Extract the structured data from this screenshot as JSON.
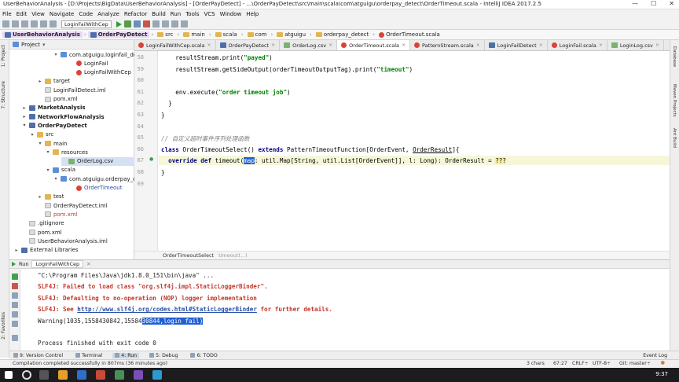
{
  "window": {
    "title": "UserBehaviorAnalysis - [D:\\Projects\\BigData\\UserBehaviorAnalysis] - [OrderPayDetect] - ...\\OrderPayDetect\\src\\main\\scala\\com\\atguigu\\orderpay_detect\\OrderTimeout.scala - IntelliJ IDEA 2017.2.5"
  },
  "menu": [
    "File",
    "Edit",
    "View",
    "Navigate",
    "Code",
    "Analyze",
    "Refactor",
    "Build",
    "Run",
    "Tools",
    "VCS",
    "Window",
    "Help"
  ],
  "toolbar": {
    "run_config": "LoginFailWithCep"
  },
  "breadcrumbs": [
    "UserBehaviorAnalysis",
    "OrderPayDetect",
    "src",
    "main",
    "scala",
    "com",
    "atguigu",
    "orderpay_detect",
    "OrderTimeout.scala"
  ],
  "project": {
    "header": "Project",
    "tree": [
      {
        "label": "com.atguigu.loginfail_detect",
        "kind": "folder-blue",
        "indent": 4,
        "arrow": "▾"
      },
      {
        "label": "LoginFail",
        "kind": "scala",
        "indent": 6,
        "arrow": ""
      },
      {
        "label": "LoginFailWithCep",
        "kind": "scala",
        "indent": 6,
        "arrow": ""
      },
      {
        "label": "target",
        "kind": "folder",
        "indent": 2,
        "arrow": "▸"
      },
      {
        "label": "LoginFailDetect.iml",
        "kind": "file",
        "indent": 2,
        "arrow": ""
      },
      {
        "label": "pom.xml",
        "kind": "file",
        "indent": 2,
        "arrow": ""
      },
      {
        "label": "MarketAnalysis",
        "kind": "module",
        "indent": 0,
        "arrow": "▸",
        "bold": true
      },
      {
        "label": "NetworkFlowAnalysis",
        "kind": "module",
        "indent": 0,
        "arrow": "▸",
        "bold": true
      },
      {
        "label": "OrderPayDetect",
        "kind": "module",
        "indent": 0,
        "arrow": "▾",
        "bold": true
      },
      {
        "label": "src",
        "kind": "folder",
        "indent": 1,
        "arrow": "▾"
      },
      {
        "label": "main",
        "kind": "folder",
        "indent": 2,
        "arrow": "▾"
      },
      {
        "label": "resources",
        "kind": "folder",
        "indent": 3,
        "arrow": "▾"
      },
      {
        "label": "OrderLog.csv",
        "kind": "csv",
        "indent": 5,
        "arrow": "",
        "selected": true
      },
      {
        "label": "scala",
        "kind": "folder-blue",
        "indent": 3,
        "arrow": "▾"
      },
      {
        "label": "com.atguigu.orderpay_detect",
        "kind": "folder-blue",
        "indent": 4,
        "arrow": "▾"
      },
      {
        "label": "OrderTimeout",
        "kind": "scala",
        "indent": 6,
        "arrow": "",
        "blue": true
      },
      {
        "label": "test",
        "kind": "folder",
        "indent": 2,
        "arrow": "▸"
      },
      {
        "label": "OrderPayDetect.iml",
        "kind": "file",
        "indent": 2,
        "arrow": ""
      },
      {
        "label": "pom.xml",
        "kind": "file",
        "indent": 2,
        "arrow": "",
        "red": true
      },
      {
        "label": ".gitignore",
        "kind": "file",
        "indent": 0,
        "arrow": ""
      },
      {
        "label": "pom.xml",
        "kind": "file",
        "indent": 0,
        "arrow": ""
      },
      {
        "label": "UserBehaviorAnalysis.iml",
        "kind": "file",
        "indent": 0,
        "arrow": ""
      },
      {
        "label": "External Libraries",
        "kind": "module",
        "indent": -1,
        "arrow": "▸"
      }
    ]
  },
  "tabs": [
    {
      "label": "LoginFailWithCep.scala",
      "active": false
    },
    {
      "label": "OrderPayDetect",
      "active": false
    },
    {
      "label": "OrderLog.csv",
      "active": false
    },
    {
      "label": "OrderTimeout.scala",
      "active": true
    },
    {
      "label": "PatternStream.scala",
      "active": false
    },
    {
      "label": "LoginFailDetect",
      "active": false
    },
    {
      "label": "LoginFail.scala",
      "active": false
    },
    {
      "label": "LoginLog.csv",
      "active": false
    }
  ],
  "editor": {
    "lines": [
      {
        "n": "58",
        "html": "    resultStream.print(<span class=\"str\">\"payed\"</span>)"
      },
      {
        "n": "59",
        "html": "    resultStream.getSideOutput(orderTimeoutOutputTag).print(<span class=\"str\">\"timeout\"</span>)"
      },
      {
        "n": "60",
        "html": ""
      },
      {
        "n": "61",
        "html": "    env.execute(<span class=\"str\">\"order timeout job\"</span>)"
      },
      {
        "n": "62",
        "html": "  }"
      },
      {
        "n": "63",
        "html": "}"
      },
      {
        "n": "64",
        "html": ""
      },
      {
        "n": "65",
        "html": "<span class=\"cmt\">// 自定义超时事件序列处理函数</span>"
      },
      {
        "n": "66",
        "html": "<span class=\"kw\">class</span> OrderTimeoutSelect() <span class=\"kw\">extends</span> PatternTimeoutFunction[OrderEvent, <span class=\"ty\">OrderResult</span>]{"
      },
      {
        "n": "67",
        "html": "  <span class=\"kw\">override def</span> timeout(<span class=\"hl-map\">map</span>: util.Map[String, util.List[OrderEvent]], l: Long): OrderResult = <span class=\"qq\">???</span>"
      },
      {
        "n": "68",
        "html": "}"
      },
      {
        "n": "69",
        "html": ""
      }
    ],
    "breadcrumb": [
      "OrderTimeoutSelect",
      "timeout(...)"
    ]
  },
  "run": {
    "label": "Run",
    "config": "LoginFailWithCep",
    "console": [
      {
        "cls": "",
        "html": "\"C:\\Program Files\\Java\\jdk1.8.0_151\\bin\\java\" ..."
      },
      {
        "cls": "slf",
        "html": "SLF4J: Failed to load class \"org.slf4j.impl.StaticLoggerBinder\"."
      },
      {
        "cls": "slf",
        "html": "SLF4J: Defaulting to no-operation (NOP) logger implementation"
      },
      {
        "cls": "slf",
        "html": "SLF4J: See <span class=\"lnk\">http://www.slf4j.org/codes.html#StaticLoggerBinder</span> for further details."
      },
      {
        "cls": "",
        "html": "Warning(1035,1558430842,15584<span class=\"sel-txt\">30844,login fail)</span>"
      },
      {
        "cls": "",
        "html": ""
      },
      {
        "cls": "",
        "html": "Process finished with exit code 0"
      }
    ]
  },
  "bottom_tabs": [
    "9: Version Control",
    "Terminal",
    "4: Run",
    "5: Debug",
    "6: TODO"
  ],
  "event_log": "Event Log",
  "status": {
    "message": "Compilation completed successfully in 807ms (36 minutes ago)",
    "chars": "3 chars",
    "position": "67:27",
    "line_sep": "CRLF÷",
    "encoding": "UTF-8÷",
    "git": "Git: master÷"
  },
  "clock": "9:37"
}
